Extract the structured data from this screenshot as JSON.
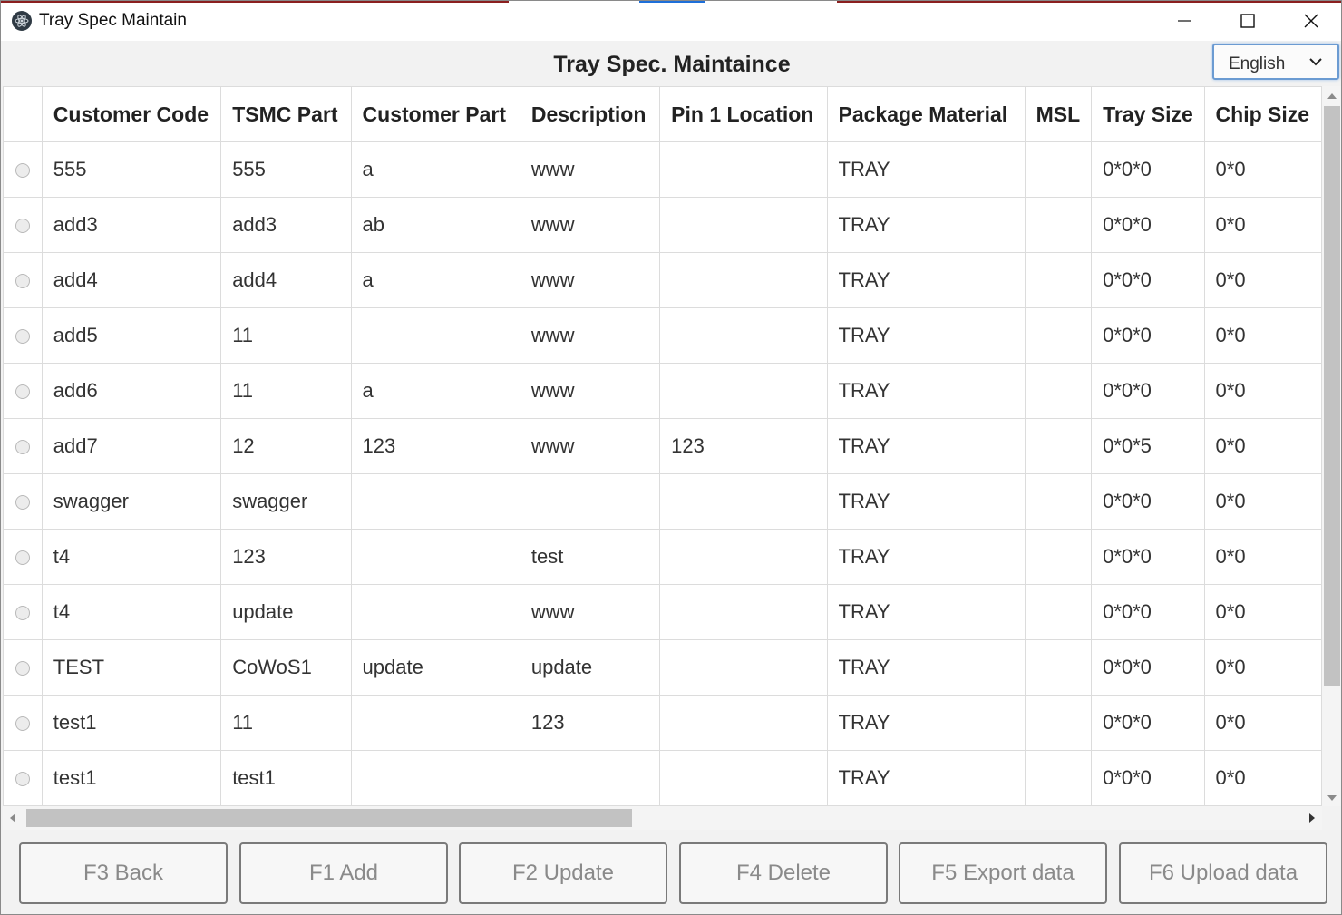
{
  "window": {
    "title": "Tray Spec Maintain",
    "icon": "atom-app-icon"
  },
  "header": {
    "title": "Tray Spec. Maintaince",
    "language": {
      "selected": "English"
    }
  },
  "table": {
    "columns": [
      "Customer Code",
      "TSMC Part",
      "Customer Part",
      "Description",
      "Pin 1 Location",
      "Package Material",
      "MSL",
      "Tray Size",
      "Chip Size"
    ],
    "rows": [
      [
        "555",
        "555",
        "a",
        "www",
        "",
        "TRAY",
        "",
        "0*0*0",
        "0*0"
      ],
      [
        "add3",
        "add3",
        "ab",
        "www",
        "",
        "TRAY",
        "",
        "0*0*0",
        "0*0"
      ],
      [
        "add4",
        "add4",
        "a",
        "www",
        "",
        "TRAY",
        "",
        "0*0*0",
        "0*0"
      ],
      [
        "add5",
        "11",
        "",
        "www",
        "",
        "TRAY",
        "",
        "0*0*0",
        "0*0"
      ],
      [
        "add6",
        "11",
        "a",
        "www",
        "",
        "TRAY",
        "",
        "0*0*0",
        "0*0"
      ],
      [
        "add7",
        "12",
        "123",
        "www",
        "123",
        "TRAY",
        "",
        "0*0*5",
        "0*0"
      ],
      [
        "swagger",
        "swagger",
        "",
        "",
        "",
        "TRAY",
        "",
        "0*0*0",
        "0*0"
      ],
      [
        "t4",
        "123",
        "",
        "test",
        "",
        "TRAY",
        "",
        "0*0*0",
        "0*0"
      ],
      [
        "t4",
        "update",
        "",
        "www",
        "",
        "TRAY",
        "",
        "0*0*0",
        "0*0"
      ],
      [
        "TEST",
        "CoWoS1",
        "update",
        "update",
        "",
        "TRAY",
        "",
        "0*0*0",
        "0*0"
      ],
      [
        "test1",
        "11",
        "",
        "123",
        "",
        "TRAY",
        "",
        "0*0*0",
        "0*0"
      ],
      [
        "test1",
        "test1",
        "",
        "",
        "",
        "TRAY",
        "",
        "0*0*0",
        "0*0"
      ]
    ]
  },
  "footer": {
    "buttons": [
      {
        "name": "back-button",
        "label": "F3 Back"
      },
      {
        "name": "add-button",
        "label": "F1 Add"
      },
      {
        "name": "update-button",
        "label": "F2 Update"
      },
      {
        "name": "delete-button",
        "label": "F4 Delete"
      },
      {
        "name": "export-data-button",
        "label": "F5 Export data"
      },
      {
        "name": "upload-data-button",
        "label": "F6 Upload data"
      }
    ]
  },
  "colors": {
    "title_accent_red": "#8b1f1f",
    "title_accent_blue": "#1e6fd9",
    "select_focus": "#6b9bd2",
    "button_border": "#7a7a7a",
    "button_text": "#8a8a8a"
  }
}
